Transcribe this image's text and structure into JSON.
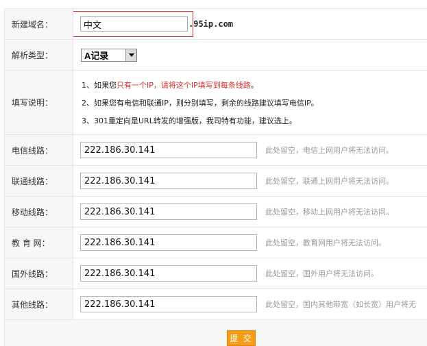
{
  "form": {
    "domain": {
      "label": "新建域名：",
      "value": "中文",
      "suffix": ".95ip.com"
    },
    "record_type": {
      "label": "解析类型：",
      "selected": "A记录"
    },
    "instructions": {
      "label": "填写说明：",
      "line1_prefix": "1、如果您",
      "line1_highlight": "只有一个IP，请将这个IP填写到每条线路",
      "line1_suffix": "。",
      "line2": "2、如果您有电信和联通IP，则分别填写，剩余的线路建议填写电信IP。",
      "line3": "3、301重定向是URL转发的增强版，我司特有功能，建议选上。"
    },
    "lines": [
      {
        "label": "电信线路：",
        "value": "222.186.30.141",
        "hint": "此处留空，电信上网用户将无法访问。"
      },
      {
        "label": "联通线路：",
        "value": "222.186.30.141",
        "hint": "此处留空，联通上网用户将无法访问。"
      },
      {
        "label": "移动线路：",
        "value": "222.186.30.141",
        "hint": "此处留空，移动上网用户将无法访问。"
      },
      {
        "label": "教 育 网：",
        "value": "222.186.30.141",
        "hint": "此处留空，教育网用户将无法访问。"
      },
      {
        "label": "国外线路：",
        "value": "222.186.30.141",
        "hint": "此处留空，国外用户将无法访问。"
      },
      {
        "label": "其他线路：",
        "value": "222.186.30.141",
        "hint": "此处留空，国内其他带宽（如长宽）用户将无"
      }
    ],
    "submit_label": "提 交"
  },
  "colors": {
    "highlight_red": "#d9302b",
    "submit_orange": "#f49d18",
    "label_bg": "#f7f7f7"
  }
}
